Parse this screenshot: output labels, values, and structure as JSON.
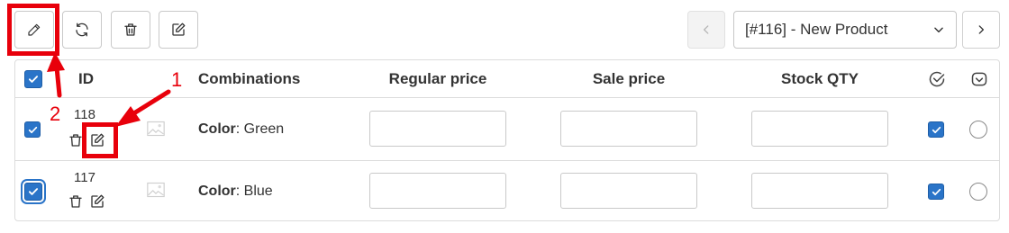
{
  "toolbar": {
    "buttons": [
      {
        "name": "edit-bulk-button",
        "icon": "pencil-icon"
      },
      {
        "name": "reload-button",
        "icon": "refresh-icon"
      },
      {
        "name": "delete-button",
        "icon": "trash-icon"
      },
      {
        "name": "edit-selected-button",
        "icon": "edit-square-icon"
      }
    ],
    "prev_icon": "chevron-left-icon",
    "next_icon": "chevron-right-icon",
    "product_select_value": "[#116] - New Product",
    "dropdown_icon": "chevron-down-icon"
  },
  "table": {
    "headers": {
      "id": "ID",
      "combinations": "Combinations",
      "regular_price": "Regular price",
      "sale_price": "Sale price",
      "stock_qty": "Stock QTY",
      "col_check_icon": "check-circle-icon",
      "col_default_icon": "default-check-icon"
    },
    "rows": [
      {
        "id": "118",
        "attribute_label": "Color",
        "attribute_value": ": Green",
        "regular_price": "",
        "sale_price": "",
        "stock_qty": "",
        "selected": true,
        "enabled": true,
        "is_default": false
      },
      {
        "id": "117",
        "attribute_label": "Color",
        "attribute_value": ": Blue",
        "regular_price": "",
        "sale_price": "",
        "stock_qty": "",
        "selected": true,
        "enabled": true,
        "is_default": false
      }
    ]
  },
  "annotations": {
    "step1": "1",
    "step2": "2",
    "color": "#e8000b"
  },
  "colors": {
    "checkbox": "#2a74c8",
    "border": "#dcdcdc"
  }
}
